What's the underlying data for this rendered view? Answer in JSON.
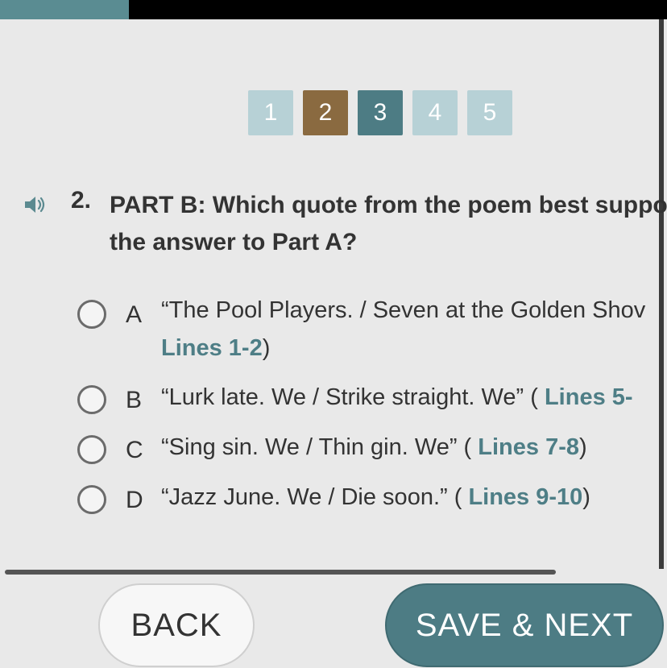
{
  "pager": {
    "pages": [
      {
        "label": "1",
        "state": "inactive"
      },
      {
        "label": "2",
        "state": "current"
      },
      {
        "label": "3",
        "state": "visited"
      },
      {
        "label": "4",
        "state": "inactive"
      },
      {
        "label": "5",
        "state": "inactive"
      }
    ]
  },
  "question": {
    "number": "2.",
    "line1": "PART B: Which quote from the poem best suppor",
    "line2": "the answer to Part A?",
    "speaker_icon": "speaker-icon"
  },
  "options": [
    {
      "letter": "A",
      "quote": "“The Pool Players. / Seven at the Golden Shov",
      "open": "",
      "ref": "Lines 1-2",
      "close": ")"
    },
    {
      "letter": "B",
      "quote": "“Lurk late. We / Strike straight. We” ( ",
      "ref": "Lines 5-",
      "close": ""
    },
    {
      "letter": "C",
      "quote": "“Sing sin. We / Thin gin. We” ( ",
      "ref": "Lines 7-8",
      "close": ")"
    },
    {
      "letter": "D",
      "quote": "“Jazz June. We / Die soon.” ( ",
      "ref": "Lines 9-10",
      "close": ")"
    }
  ],
  "buttons": {
    "back": "BACK",
    "save_next": "SAVE & NEXT"
  },
  "colors": {
    "accent": "#4d7c84",
    "current_page": "#8a6a40",
    "inactive_page": "#b7d1d6"
  }
}
